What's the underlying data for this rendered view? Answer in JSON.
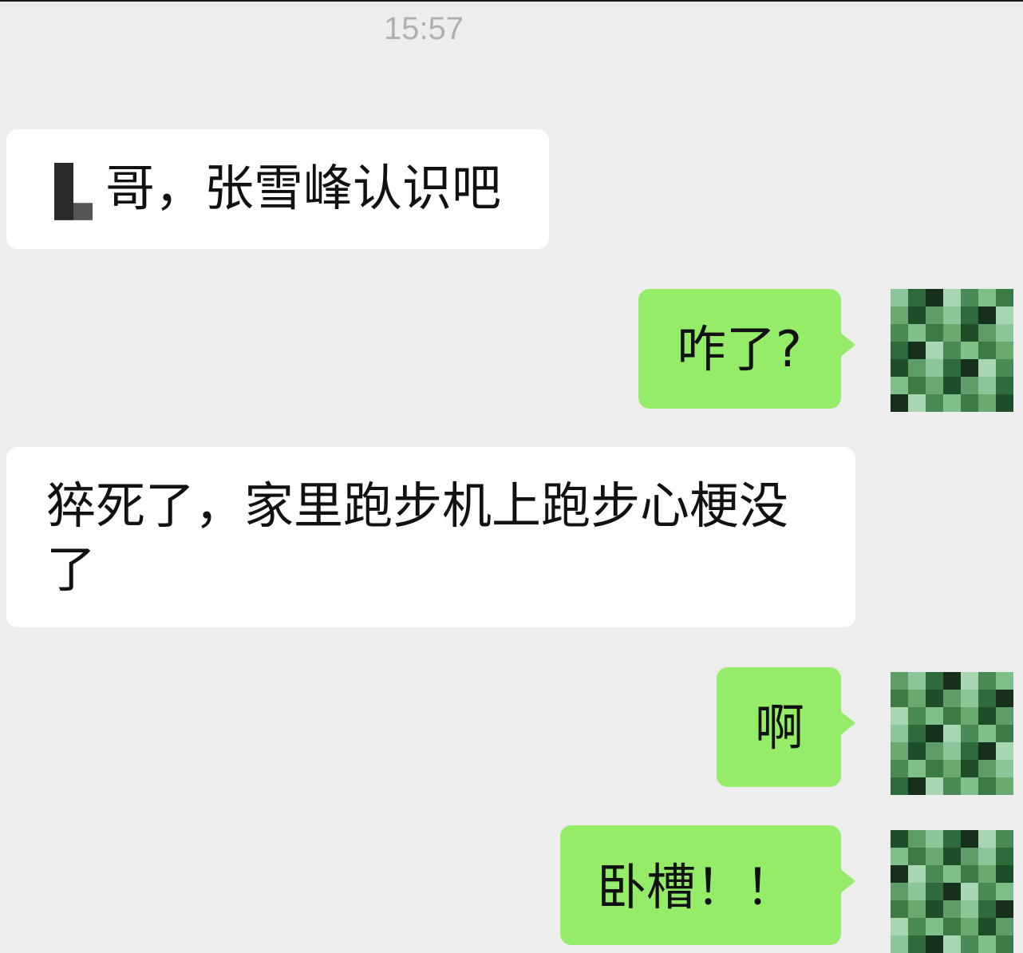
{
  "header": {
    "timestamp": "15:57"
  },
  "messages": [
    {
      "side": "incoming",
      "text": "哥，张雪峰认识吧"
    },
    {
      "side": "outgoing",
      "text": "咋了?"
    },
    {
      "side": "incoming",
      "text": "猝死了，家里跑步机上跑步心梗没了"
    },
    {
      "side": "outgoing",
      "text": "啊"
    },
    {
      "side": "outgoing",
      "text": "卧槽！！"
    }
  ],
  "colors": {
    "background": "#ededed",
    "incoming_bubble": "#ffffff",
    "outgoing_bubble": "#95ec69",
    "timestamp": "#b0b0b0"
  },
  "icons": {
    "avatar": "pixelated-avatar-icon",
    "sender_mark": "blurred-name-icon"
  }
}
